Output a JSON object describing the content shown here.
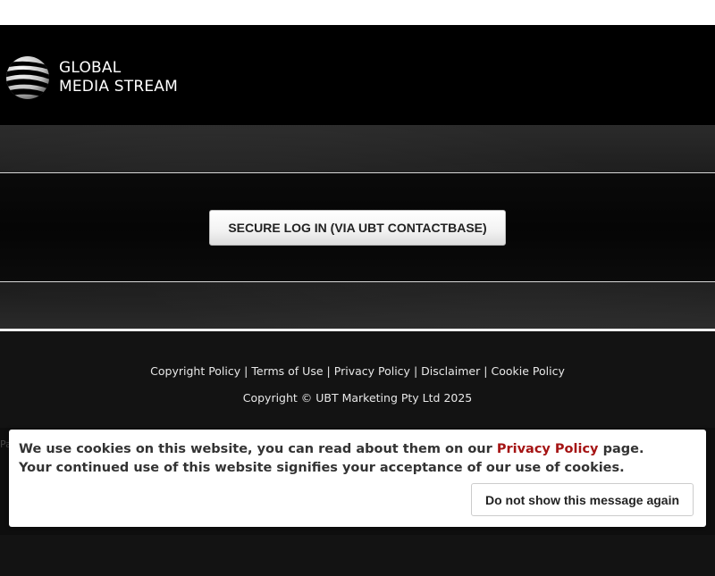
{
  "header": {
    "brand_line1": "GLOBAL",
    "brand_line2": "MEDIA STREAM",
    "logo_icon": "striped-globe-icon"
  },
  "hero": {
    "login_button": "SECURE LOG IN (VIA UBT CONTACTBASE)"
  },
  "footer": {
    "links": [
      "Copyright Policy",
      "Terms of Use",
      "Privacy Policy",
      "Disclaimer",
      "Cookie Policy"
    ],
    "link_separator": "|",
    "copyright": "Copyright © UBT Marketing Pty Ltd 2025",
    "stray_text": "Pa"
  },
  "cookie_banner": {
    "line1_prefix": "We use cookies on this website, you can read about them on our ",
    "line1_link": "Privacy Policy",
    "line1_suffix": " page.",
    "line2": "Your continued use of this website signifies your acceptance of our use of cookies.",
    "dismiss_button": "Do not show this message again"
  },
  "colors": {
    "header_bg": "#000000",
    "footer_bg": "#131313",
    "link_accent": "#a51414",
    "banner_bg": "#ffffff"
  }
}
